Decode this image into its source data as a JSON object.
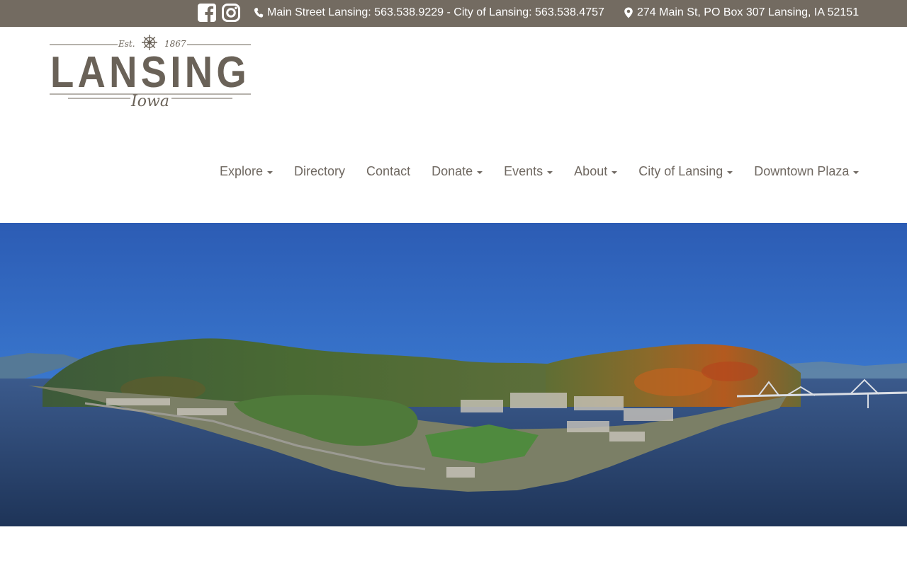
{
  "topbar": {
    "social": [
      {
        "icon": "facebook-square-icon"
      },
      {
        "icon": "instagram-icon"
      }
    ],
    "phone_text": "Main Street Lansing: 563.538.9229 - City of Lansing: 563.538.4757",
    "address_text": "274 Main St, PO Box 307 Lansing, IA 52151",
    "background": "#736b61"
  },
  "logo": {
    "est": "Est.",
    "year": "1867",
    "name": "LANSING",
    "state": "Iowa",
    "color": "#6a6258"
  },
  "nav": {
    "items": [
      {
        "label": "Explore",
        "dropdown": true
      },
      {
        "label": "Directory",
        "dropdown": false
      },
      {
        "label": "Contact",
        "dropdown": false
      },
      {
        "label": "Donate",
        "dropdown": true
      },
      {
        "label": "Events",
        "dropdown": true
      },
      {
        "label": "About",
        "dropdown": true
      },
      {
        "label": "City of Lansing",
        "dropdown": true
      },
      {
        "label": "Downtown Plaza",
        "dropdown": true
      }
    ],
    "text_color": "#6f6861"
  },
  "hero": {
    "image": "aerial-panorama-of-lansing-on-mississippi-river"
  }
}
